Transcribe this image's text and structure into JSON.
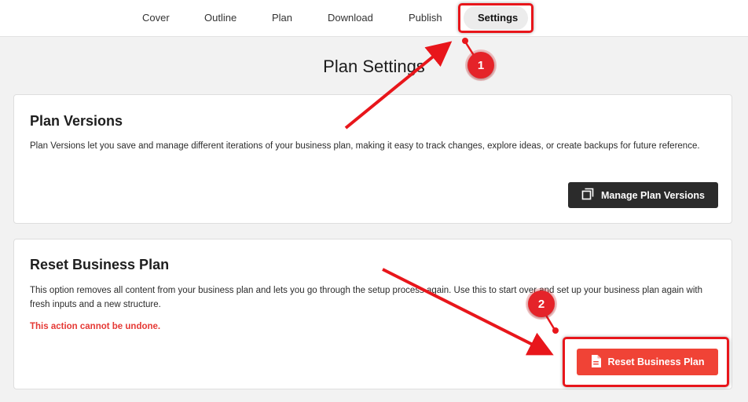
{
  "nav": {
    "tabs": [
      {
        "label": "Cover"
      },
      {
        "label": "Outline"
      },
      {
        "label": "Plan"
      },
      {
        "label": "Download"
      },
      {
        "label": "Publish"
      },
      {
        "label": "Settings",
        "active": true
      }
    ]
  },
  "page_title": "Plan Settings",
  "versions_card": {
    "title": "Plan Versions",
    "description": "Plan Versions let you save and manage different iterations of your business plan, making it easy to track changes, explore ideas, or create backups for future reference.",
    "button_label": "Manage Plan Versions",
    "button_icon": "copy-icon"
  },
  "reset_card": {
    "title": "Reset Business Plan",
    "description": "This option removes all content from your business plan and lets you go through the setup process again. Use this to start over and set up your business plan again with fresh inputs and a new structure.",
    "warning": "This action cannot be undone.",
    "button_label": "Reset Business Plan",
    "button_icon": "document-icon"
  },
  "annotations": {
    "step1": "1",
    "step2": "2"
  },
  "colors": {
    "accent_red": "#f04336",
    "annotation_red": "#e8161b",
    "dark_button": "#2b2b2b",
    "warning_text": "#e53935"
  }
}
